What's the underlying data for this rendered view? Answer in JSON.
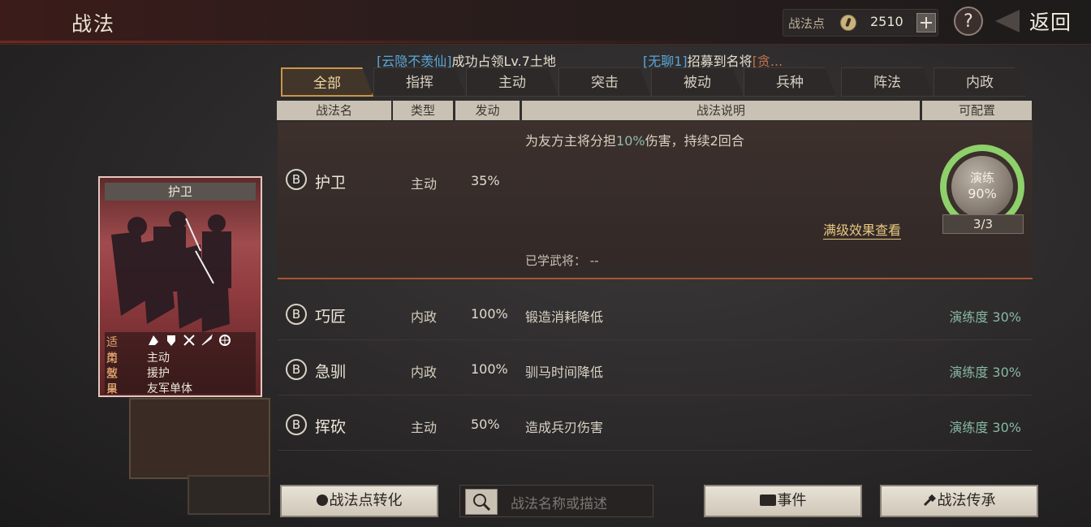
{
  "header": {
    "title": "战法",
    "points_label": "战法点",
    "points_value": "2510",
    "help_symbol": "?",
    "back_label": "返回"
  },
  "ticker": {
    "msg1_name": "[云隐不羡仙]",
    "msg1_text": "成功占领Lv.7土地",
    "msg2_name": "[无聊1]",
    "msg2_text": "招募到名将",
    "msg2_tail": "[贪..."
  },
  "tabs": [
    {
      "label": "全部",
      "active": true
    },
    {
      "label": "指挥"
    },
    {
      "label": "主动"
    },
    {
      "label": "突击"
    },
    {
      "label": "被动"
    },
    {
      "label": "兵种"
    },
    {
      "label": "阵法"
    },
    {
      "label": "内政"
    }
  ],
  "columns": {
    "name": "战法名",
    "type": "类型",
    "rate": "发动",
    "desc": "战法说明",
    "config": "可配置"
  },
  "selected_skill": {
    "grade": "B",
    "name": "护卫",
    "type": "主动",
    "rate": "35%",
    "desc_pre": "为友方主将分担",
    "desc_pct": "10%",
    "desc_post": "伤害，持续2回合",
    "max_effect_link": "满级效果查看",
    "learned_label": "已学武将：  --",
    "train_label": "演练",
    "train_pct": "90%",
    "train_count": "3/3"
  },
  "skills": [
    {
      "grade": "B",
      "name": "巧匠",
      "type": "内政",
      "rate": "100%",
      "desc": "锻造消耗降低",
      "train": "演练度 30%"
    },
    {
      "grade": "B",
      "name": "急驯",
      "type": "内政",
      "rate": "100%",
      "desc": "驯马时间降低",
      "train": "演练度 30%"
    },
    {
      "grade": "B",
      "name": "挥砍",
      "type": "主动",
      "rate": "50%",
      "desc": "造成兵刃伤害",
      "train": "演练度 30%"
    }
  ],
  "card": {
    "title": "护卫",
    "applies_key": "适用",
    "type_key": "类型",
    "type_val": "主动",
    "effect_key": "效果",
    "effect_val": "援护",
    "target_key": "目标",
    "target_val": "友军单体"
  },
  "buttons": {
    "convert": "战法点转化",
    "search_placeholder": "战法名称或描述",
    "events": "事件",
    "inherit": "战法传承"
  },
  "colors": {
    "accent_gold": "#c9964a",
    "train_green": "#8ed06a",
    "card_red": "#a04b4e"
  }
}
